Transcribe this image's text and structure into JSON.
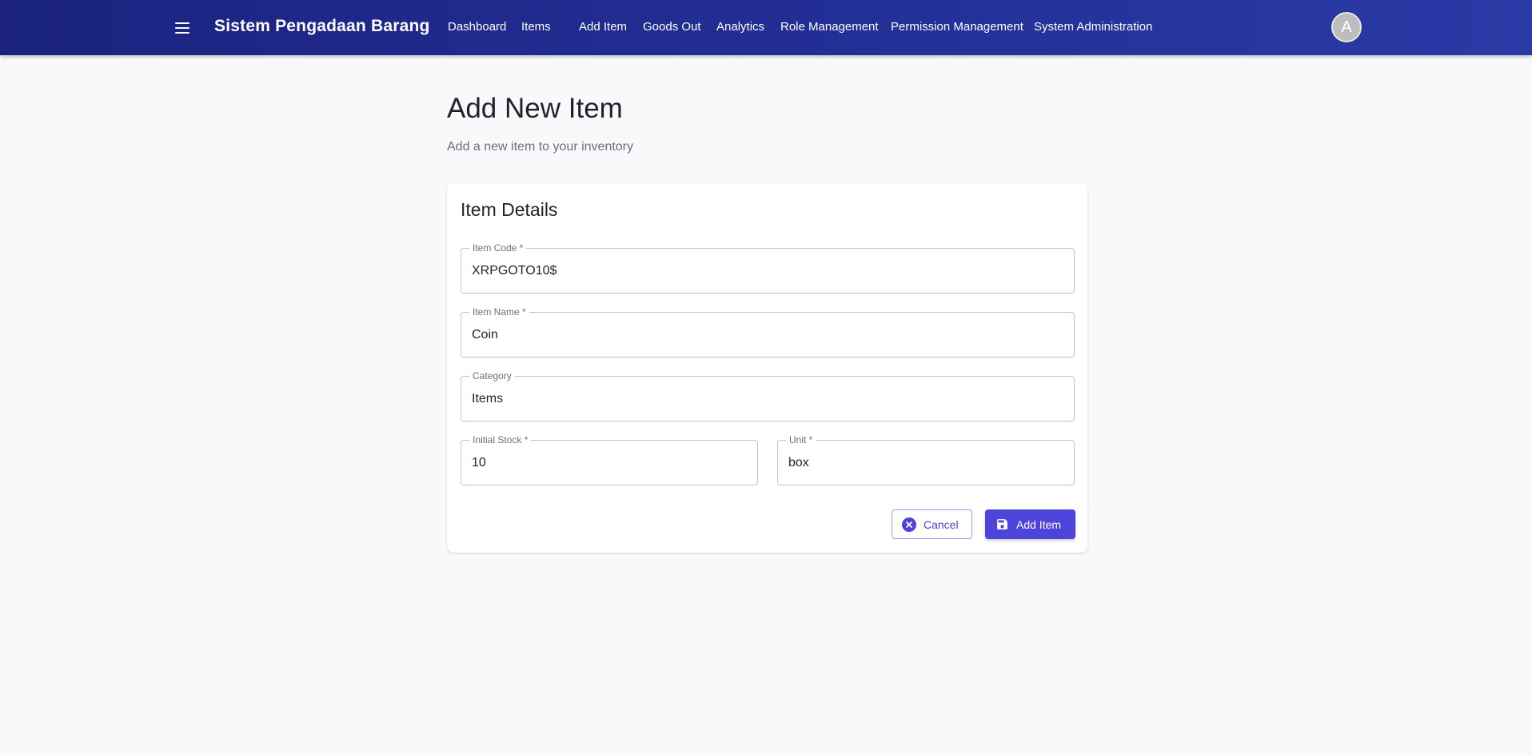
{
  "header": {
    "app_title": "Sistem Pengadaan Barang",
    "menu_icon": "menu-icon",
    "nav": [
      {
        "label": "Dashboard"
      },
      {
        "label": "Items"
      },
      {
        "label": "Add Item"
      },
      {
        "label": "Goods Out"
      },
      {
        "label": "Analytics"
      },
      {
        "label": "Role Management"
      },
      {
        "label": "Permission Management"
      },
      {
        "label": "System Administration"
      }
    ],
    "avatar_initial": "A"
  },
  "page": {
    "title": "Add New Item",
    "subtitle": "Add a new item to your inventory"
  },
  "form": {
    "card_title": "Item Details",
    "item_code": {
      "label": "Item Code *",
      "value": "XRPGOTO10$"
    },
    "item_name": {
      "label": "Item Name *",
      "value": "Coin"
    },
    "category": {
      "label": "Category",
      "value": "Items"
    },
    "initial_stock": {
      "label": "Initial Stock *",
      "value": "10"
    },
    "unit": {
      "label": "Unit *",
      "value": "box"
    },
    "cancel_label": "Cancel",
    "submit_label": "Add Item"
  },
  "colors": {
    "header_bg": "#1b237f",
    "accent": "#4d44dc",
    "page_bg": "#f8f9fb"
  }
}
